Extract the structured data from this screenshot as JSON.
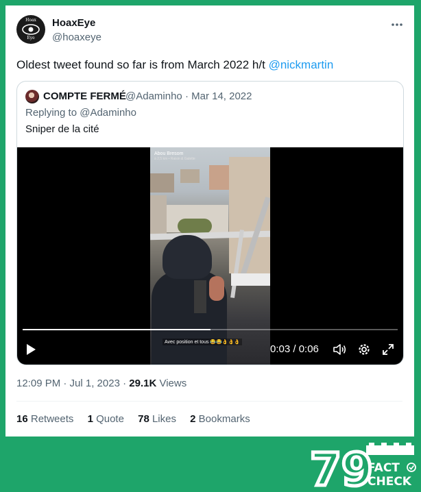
{
  "tweet": {
    "display_name": "HoaxEye",
    "handle": "@hoaxeye",
    "avatar_text_top": "Hoax",
    "avatar_text_bottom": "Eye",
    "more_icon": "more-horizontal-icon",
    "text": "Oldest tweet found so far is from March 2022 h/t ",
    "mention": "@nickmartin",
    "timestamp": "12:09 PM · Jul 1, 2023 · ",
    "views_count": "29.1K",
    "views_label": " Views",
    "stats": [
      {
        "count": "16",
        "label": " Retweets"
      },
      {
        "count": "1",
        "label": " Quote"
      },
      {
        "count": "78",
        "label": " Likes"
      },
      {
        "count": "2",
        "label": " Bookmarks"
      }
    ]
  },
  "quoted": {
    "display_name": "COMPTE FERMÉ",
    "meta": "@Adaminho · Mar 14, 2022",
    "replying_to": "Replying to @Adaminho",
    "text": "Sniper de la cité",
    "video": {
      "overlay_title": "Abou Bresom",
      "overlay_sub": "à 2,5 km • Raisin & Galette",
      "overlay_caption": "Avec position et tous 😂😂👌👌👌",
      "time": "0:03 / 0:06",
      "progress": 0.5
    }
  },
  "brand": {
    "logo_number": "79",
    "logo_line1": "FACT",
    "logo_line2": "CHECK",
    "background": "#1ea56a",
    "link_color": "#1d9bf0"
  }
}
